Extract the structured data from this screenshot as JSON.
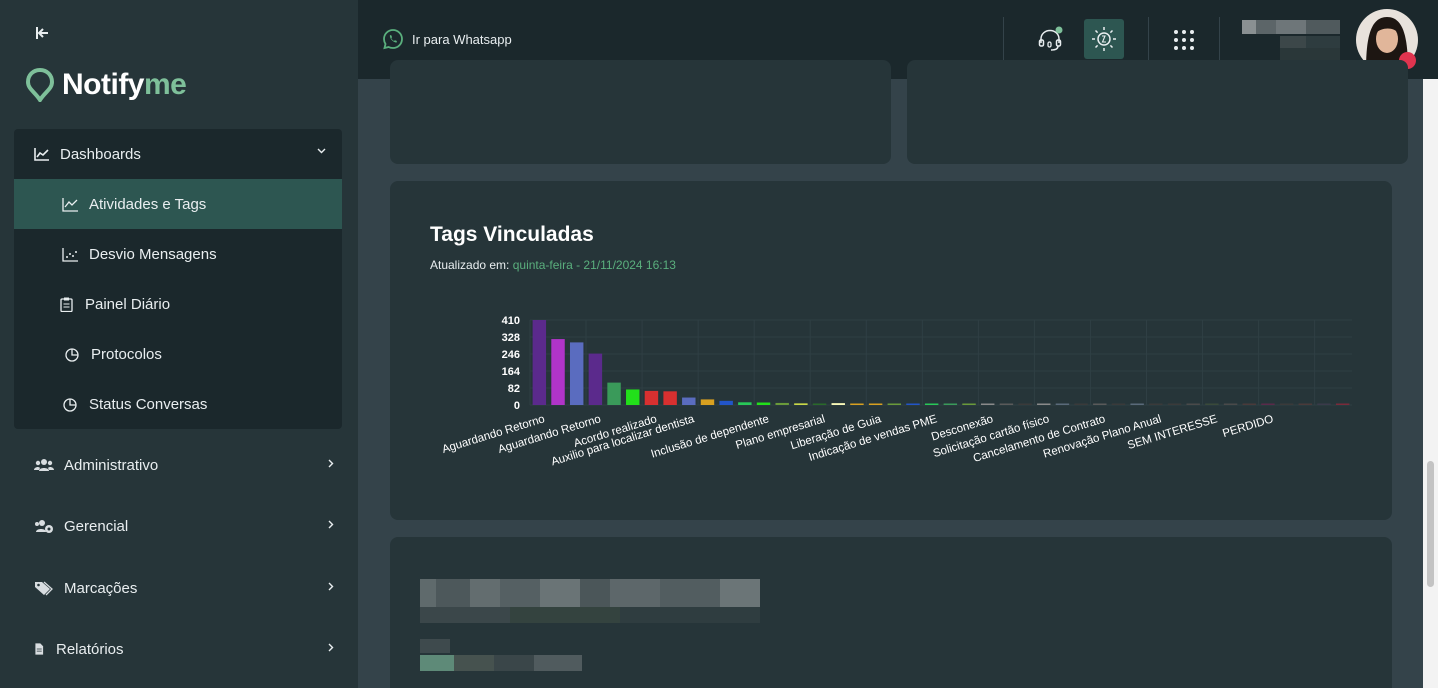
{
  "app": {
    "logo_text_a": "Notify",
    "logo_text_b": "me"
  },
  "sidebar": {
    "dashboards": {
      "label": "Dashboards",
      "items": [
        {
          "label": "Atividades e Tags",
          "icon": "line-chart-icon",
          "active": true
        },
        {
          "label": "Desvio Mensagens",
          "icon": "scatter-chart-icon",
          "active": false
        },
        {
          "label": "Painel Diário",
          "icon": "clipboard-icon",
          "active": false
        },
        {
          "label": "Protocolos",
          "icon": "pie-chart-icon",
          "active": false
        },
        {
          "label": "Status Conversas",
          "icon": "pie-chart-icon",
          "active": false
        }
      ]
    },
    "nav": [
      {
        "label": "Administrativo",
        "icon": "users-icon"
      },
      {
        "label": "Gerencial",
        "icon": "users-gear-icon"
      },
      {
        "label": "Marcações",
        "icon": "tags-icon"
      },
      {
        "label": "Relatórios",
        "icon": "document-icon"
      }
    ]
  },
  "topbar": {
    "whatsapp_label": "Ir para Whatsapp"
  },
  "tags_card": {
    "title": "Tags Vinculadas",
    "updated_prefix": "Atualizado em:",
    "updated_date": "quinta-feira - 21/11/2024 16:13"
  },
  "colors": {
    "accent": "#2d5651",
    "brand_green": "#7ec09a",
    "date_green": "#5aaf7d",
    "status_red": "#e0344f"
  },
  "chart_data": {
    "type": "bar",
    "y_ticks": [
      "410",
      "328",
      "246",
      "164",
      "82",
      "0"
    ],
    "ylim": [
      0,
      410
    ],
    "grid": true,
    "bars": [
      {
        "value": 410,
        "color": "#5b2a8c"
      },
      {
        "value": 318,
        "color": "#b034c8"
      },
      {
        "value": 302,
        "color": "#5a6cbf"
      },
      {
        "value": 248,
        "color": "#5b2a8c"
      },
      {
        "value": 108,
        "color": "#3a9a5a"
      },
      {
        "value": 75,
        "color": "#22e01a"
      },
      {
        "value": 68,
        "color": "#d83030"
      },
      {
        "value": 66,
        "color": "#d83030"
      },
      {
        "value": 36,
        "color": "#5a6cbf"
      },
      {
        "value": 27,
        "color": "#d8a020"
      },
      {
        "value": 20,
        "color": "#2255c8"
      },
      {
        "value": 13,
        "color": "#28c858"
      },
      {
        "value": 12,
        "color": "#22e01a"
      },
      {
        "value": 10,
        "color": "#6a9a3a"
      },
      {
        "value": 8,
        "color": "#c8d848"
      },
      {
        "value": 7,
        "color": "#2a6a2a"
      },
      {
        "value": 9,
        "color": "#f8f8b8"
      },
      {
        "value": 7,
        "color": "#d8a020"
      },
      {
        "value": 6,
        "color": "#d8a020"
      },
      {
        "value": 5,
        "color": "#6a9a3a"
      },
      {
        "value": 4,
        "color": "#2255c8"
      },
      {
        "value": 4,
        "color": "#28c858"
      },
      {
        "value": 3,
        "color": "#3a9a5a"
      },
      {
        "value": 2,
        "color": "#6a9a3a"
      },
      {
        "value": 2,
        "color": "#8a8a8a"
      },
      {
        "value": 2,
        "color": "#5a5a5a"
      },
      {
        "value": 1,
        "color": "#3a3a3a"
      },
      {
        "value": 1,
        "color": "#8a8a8a"
      },
      {
        "value": 1,
        "color": "#5a6a7a"
      },
      {
        "value": 1,
        "color": "#3a3a3a"
      },
      {
        "value": 1,
        "color": "#5a5a5a"
      },
      {
        "value": 1,
        "color": "#3a3a3a"
      },
      {
        "value": 1,
        "color": "#5a6a7a"
      },
      {
        "value": 1,
        "color": "#3a3a3a"
      },
      {
        "value": 1,
        "color": "#3a3a3a"
      },
      {
        "value": 1,
        "color": "#4a4a4a"
      },
      {
        "value": 1,
        "color": "#3a4a3a"
      },
      {
        "value": 1,
        "color": "#4a4a4a"
      },
      {
        "value": 1,
        "color": "#4a3a3a"
      },
      {
        "value": 1,
        "color": "#5a2a4a"
      },
      {
        "value": 1,
        "color": "#3a3a3a"
      },
      {
        "value": 1,
        "color": "#4a3a3a"
      },
      {
        "value": 1,
        "color": "#3a3a4a"
      },
      {
        "value": 1,
        "color": "#7a2a3a"
      }
    ],
    "labels": [
      {
        "text": "Aguardando Retorno",
        "index": 0
      },
      {
        "text": "Aguardando Retorno",
        "index": 3
      },
      {
        "text": "Acordo realizado",
        "index": 6
      },
      {
        "text": "Auxilio para localizar dentista",
        "index": 8
      },
      {
        "text": "Inclusão de dependente",
        "index": 12
      },
      {
        "text": "Plano empresarial",
        "index": 15
      },
      {
        "text": "Liberação de Guia",
        "index": 18
      },
      {
        "text": "Indicação de vendas PME",
        "index": 21
      },
      {
        "text": "Desconexão",
        "index": 24
      },
      {
        "text": "Solicitação cartão físico",
        "index": 27
      },
      {
        "text": "Cancelamento de Contrato",
        "index": 30
      },
      {
        "text": "Renovação Plano Anual",
        "index": 33
      },
      {
        "text": "SEM INTERESSE",
        "index": 36
      },
      {
        "text": "PERDIDO",
        "index": 39
      }
    ]
  }
}
